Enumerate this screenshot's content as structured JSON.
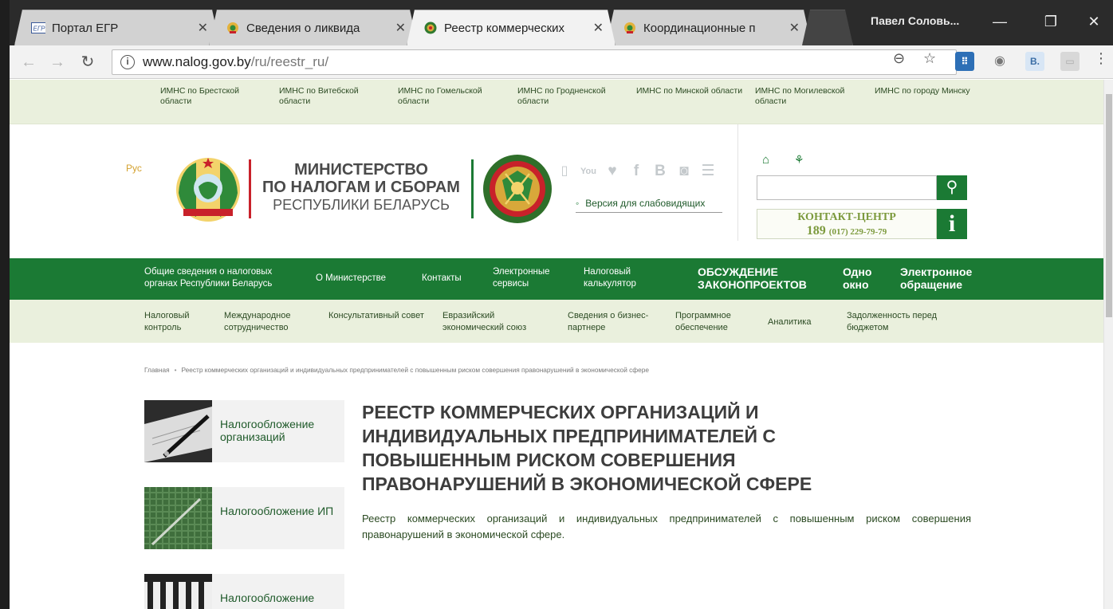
{
  "browser": {
    "tabs": [
      {
        "title": "Портал ЕГР",
        "icon": "egr-icon",
        "icon_label": "ЕГР"
      },
      {
        "title": "Сведения о ликвида",
        "icon": "emblem-icon"
      },
      {
        "title": "Реестр коммерческих",
        "icon": "ministry-icon",
        "active": true
      },
      {
        "title": "Координационные п",
        "icon": "emblem-icon"
      }
    ],
    "user_name": "Павел Соловь...",
    "url_host": "www.nalog.gov.by",
    "url_path": "/ru/reestr_ru/",
    "extensions": [
      {
        "name": "vk-ext-icon",
        "label": "В."
      }
    ]
  },
  "regions": [
    "ИМНС по Брестской области",
    "ИМНС по Витебской области",
    "ИМНС по Гомельской области",
    "ИМНС по Гродненской области",
    "ИМНС по Минской области",
    "ИМНС по Могилевской области",
    "ИМНС по городу Минску"
  ],
  "header": {
    "lang": "Рус",
    "ministry_line1": "МИНИСТЕРСТВО",
    "ministry_line2": "ПО НАЛОГАМ И СБОРАМ",
    "ministry_line3": "РЕСПУБЛИКИ БЕЛАРУСЬ",
    "low_vision": "Версия для слабовидящих",
    "contact_title": "КОНТАКТ-ЦЕНТР",
    "contact_short": "189",
    "contact_phone": "(017) 229-79-79",
    "info_letter": "i",
    "social": [
      "mobile-icon",
      "youtube-icon",
      "twitter-icon",
      "facebook-icon",
      "vk-icon",
      "instagram-icon",
      "rss-icon"
    ]
  },
  "main_nav": [
    {
      "label": "Общие сведения о налоговых органах Республики Беларусь"
    },
    {
      "label": "О Министерстве"
    },
    {
      "label": "Контакты"
    },
    {
      "label": "Электронные сервисы"
    },
    {
      "label": "Налоговый калькулятор"
    },
    {
      "label": "ОБСУЖДЕНИЕ ЗАКОНОПРОЕКТОВ"
    },
    {
      "label": "Одно окно"
    },
    {
      "label": "Электронное обращение"
    }
  ],
  "sub_nav": [
    "Налоговый контроль",
    "Международное сотрудничество",
    "Консультативный совет",
    "Евразийский экономический союз",
    "Сведения о бизнес-партнере",
    "Программное обеспечение",
    "Аналитика",
    "Задолженность перед бюджетом"
  ],
  "breadcrumb": {
    "home": "Главная",
    "current": "Реестр коммерческих организаций и индивидуальных предпринимателей с повышенным риском совершения правонарушений в экономической сфере"
  },
  "sidebar": [
    {
      "label": "Налогообложение организаций"
    },
    {
      "label": "Налогообложение ИП"
    },
    {
      "label": "Налогообложение"
    }
  ],
  "content": {
    "title": "РЕЕСТР КОММЕРЧЕСКИХ ОРГАНИЗАЦИЙ И ИНДИВИДУАЛЬНЫХ ПРЕДПРИНИМАТЕЛЕЙ С ПОВЫШЕННЫМ РИСКОМ СОВЕРШЕНИЯ ПРАВОНАРУШЕНИЙ В ЭКОНОМИЧЕСКОЙ СФЕРЕ",
    "description": "Реестр коммерческих организаций и индивидуальных предпринимателей с повышенным риском совершения правонарушений в экономической сфере."
  },
  "colors": {
    "brand_green": "#1b7a34",
    "light_green": "#eaf0dd",
    "accent_red": "#c8212a",
    "contact_olive": "#7c9a3d"
  }
}
